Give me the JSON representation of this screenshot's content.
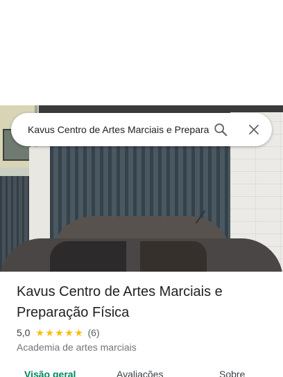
{
  "search": {
    "query": "Kavus Centro de Artes Marciais e Preparação Física",
    "search_icon": "search-icon",
    "close_icon": "close-icon"
  },
  "place": {
    "title": "Kavus Centro de Artes Marciais e Preparação Física",
    "rating": "5,0",
    "stars": 5,
    "review_count": "(6)",
    "category": "Academia de artes marciais"
  },
  "tabs": [
    {
      "label": "Visão geral",
      "active": true
    },
    {
      "label": "Avaliações",
      "active": false
    },
    {
      "label": "Sobre",
      "active": false
    }
  ],
  "colors": {
    "star": "#fbbc04",
    "active_tab": "#01875f",
    "title_text": "#202124"
  }
}
